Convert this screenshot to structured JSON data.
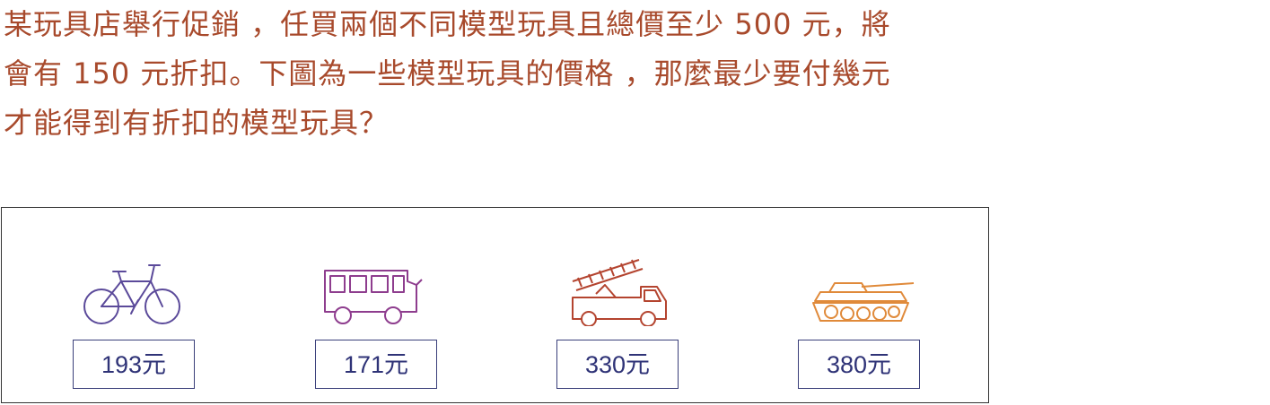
{
  "question": {
    "lines": [
      "某玩具店舉行促銷 ，任買兩個不同模型玩具且總價至少 500 元，將",
      "會有 150 元折扣。下圖為一些模型玩具的價格 ，那麼最少要付幾元",
      "才能得到有折扣的模型玩具？"
    ]
  },
  "colors": {
    "question_text": "#a84a2c",
    "price_text": "#2f3377",
    "bicycle": "#5b4a9a",
    "bus": "#8e3d8e",
    "truck": "#b4442f",
    "tank": "#e08a3a"
  },
  "items": [
    {
      "icon": "bicycle-icon",
      "price": "193",
      "unit": "元"
    },
    {
      "icon": "bus-icon",
      "price": "171",
      "unit": "元"
    },
    {
      "icon": "ladder-truck-icon",
      "price": "330",
      "unit": "元"
    },
    {
      "icon": "tank-icon",
      "price": "380",
      "unit": "元"
    }
  ]
}
